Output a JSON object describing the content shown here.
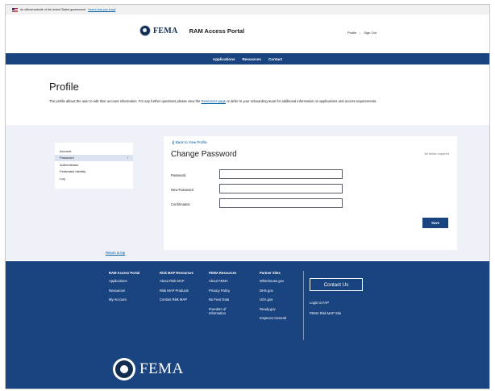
{
  "gov_banner": {
    "text": "An official website of the United States government",
    "link": "Here's how you know"
  },
  "header": {
    "logo_text": "FEMA",
    "portal_title": "RAM Access Portal",
    "profile_link": "Profile",
    "separator": "|",
    "signout_link": "Sign Out"
  },
  "nav": {
    "items": [
      "Applications",
      "Resources",
      "Contact"
    ]
  },
  "intro": {
    "title": "Profile",
    "text_before": "The profile allows the user to edit their account information. For any further questions please view the ",
    "link": "Resources page",
    "text_after": " or defer to your onboarding team for additional information on applications and access requirements."
  },
  "sidebar": {
    "items": [
      {
        "label": "Account"
      },
      {
        "label": "Password",
        "active": true,
        "chevron": "›"
      },
      {
        "label": "Authenticator"
      },
      {
        "label": "Federated Identity"
      },
      {
        "label": "Log"
      }
    ]
  },
  "card": {
    "back_link": "❮ Back to View Profile",
    "title": "Change Password",
    "required_note": "All fields required",
    "fields": [
      {
        "label": "Password",
        "value": ""
      },
      {
        "label": "New Password",
        "value": ""
      },
      {
        "label": "Confirmation",
        "value": ""
      }
    ],
    "save_label": "Save"
  },
  "return_to_top": "Return to top",
  "footer": {
    "columns": [
      {
        "heading": "RAM Access Portal",
        "links": [
          "Applications",
          "Resources",
          "My Account"
        ]
      },
      {
        "heading": "Risk MAP Resources",
        "links": [
          "About Risk MAP",
          "Risk MAP Products",
          "Contact Risk MAP"
        ]
      },
      {
        "heading": "FEMA Resources",
        "links": [
          "About FEMA",
          "Privacy Policy",
          "No Fear Data",
          "Freedom of Information"
        ]
      },
      {
        "heading": "Partner Sites",
        "links": [
          "Whitehouse.gov",
          "DHS.gov",
          "USA.gov",
          "Ready.gov",
          "Inspector General"
        ]
      }
    ],
    "contact_button": "Contact Us",
    "side_links": [
      "Login to FAP",
      "FEMA Risk MAP Site"
    ],
    "logo_text": "FEMA"
  },
  "colors": {
    "nav_blue": "#1a4480",
    "link_blue": "#005ea2",
    "content_bg": "#eef1f7",
    "active_item": "#dbe3f0"
  },
  "icons": [
    "us-flag-icon",
    "dhs-seal-icon",
    "chevron-right-icon",
    "chevron-left-icon"
  ]
}
